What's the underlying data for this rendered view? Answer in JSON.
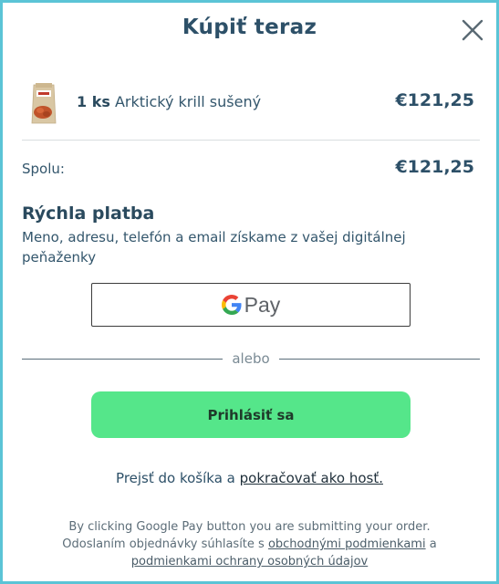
{
  "header": {
    "title": "Kúpiť teraz",
    "close_icon": "close-icon"
  },
  "cart": {
    "item": {
      "quantity": "1 ks",
      "name": "Arktický krill sušený",
      "price": "€121,25",
      "thumbnail_icon": "product-bag-image"
    },
    "total_label": "Spolu:",
    "total_value": "€121,25"
  },
  "fast_pay": {
    "title": "Rýchla platba",
    "description": "Meno, adresu, telefón a email získame z vašej digitálnej peňaženky",
    "gpay_label": "Pay"
  },
  "separator_text": "alebo",
  "login_label": "Prihlásiť sa",
  "guest": {
    "prefix": "Prejsť do košíka a ",
    "link": "pokračovať ako hosť."
  },
  "legal": {
    "line1": "By clicking Google Pay button you are submitting your order.",
    "line2_prefix": "Odoslaním objednávky súhlasíte s ",
    "terms_link": "obchodnými podmienkami",
    "conj": " a",
    "privacy_link": "podmienkami ochrany osobných údajov"
  },
  "colors": {
    "frame_border": "#5bc4d6",
    "primary_text": "#2d5068",
    "login_button": "#55e68a",
    "google_blue": "#4285F4",
    "google_red": "#EA4335",
    "google_yellow": "#FBBC05",
    "google_green": "#34A853"
  }
}
